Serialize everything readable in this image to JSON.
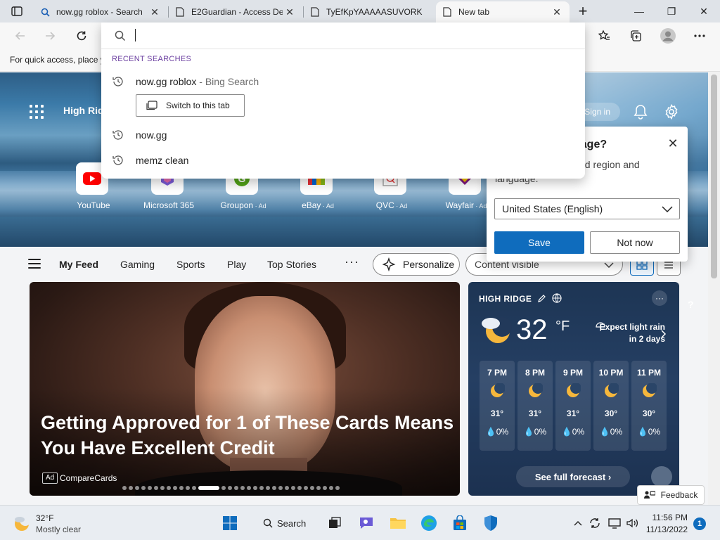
{
  "browser": {
    "tabs": [
      {
        "title": "now.gg roblox - Search",
        "icon": "search-icon",
        "active": false
      },
      {
        "title": "E2Guardian - Access De",
        "icon": "page-icon",
        "active": false
      },
      {
        "title": "TyEfKpYAAAAASUVORK",
        "icon": "page-icon",
        "active": false
      },
      {
        "title": "New tab",
        "icon": "page-icon",
        "active": true
      }
    ],
    "new_tab_symbol": "+",
    "window_controls": {
      "minimize": "—",
      "restore": "❐",
      "close": "✕"
    }
  },
  "address_bar": {
    "value": "",
    "recent_header": "RECENT SEARCHES",
    "suggestions": [
      {
        "text": "now.gg roblox",
        "sub": " - Bing Search"
      },
      {
        "text": "now.gg",
        "sub": ""
      },
      {
        "text": "memz clean",
        "sub": ""
      }
    ],
    "switch_tab_label": "Switch to this tab"
  },
  "favorites_bar": {
    "text": "For quick access, place y"
  },
  "page": {
    "location": "High Rid",
    "signin_label": "Sign in",
    "quick_links": [
      {
        "label": "YouTube",
        "ad": "",
        "color": "#ff0000"
      },
      {
        "label": "Microsoft 365",
        "ad": "",
        "color": "#7b5bd6"
      },
      {
        "label": "Groupon",
        "ad": " · Ad",
        "color": "#53a318"
      },
      {
        "label": "eBay",
        "ad": " · Ad",
        "color": "#e53238"
      },
      {
        "label": "QVC",
        "ad": " · Ad",
        "color": "#9e9e9e"
      },
      {
        "label": "Wayfair",
        "ad": " · Ad",
        "color": "#7f187f"
      }
    ],
    "feed_nav": {
      "items": [
        "My Feed",
        "Gaming",
        "Sports",
        "Play",
        "Top Stories"
      ],
      "more": "···",
      "personalize": "Personalize",
      "content_select": "Content visible"
    },
    "article": {
      "title": "Getting Approved for 1 of These Cards Means You Have Excellent Credit",
      "ad_badge": "Ad",
      "source": "CompareCards"
    },
    "weather": {
      "location": "HIGH RIDGE",
      "temp": "32",
      "unit": "°F",
      "alert": "Expect light rain in 2 days",
      "more": "···",
      "hours": [
        {
          "time": "7 PM",
          "temp": "31°",
          "precip": "0%"
        },
        {
          "time": "8 PM",
          "temp": "31°",
          "precip": "0%"
        },
        {
          "time": "9 PM",
          "temp": "31°",
          "precip": "0%"
        },
        {
          "time": "10 PM",
          "temp": "30°",
          "precip": "0%"
        },
        {
          "time": "11 PM",
          "temp": "30°",
          "precip": "0%"
        }
      ],
      "forecast_btn": "See full forecast ›"
    },
    "feedback_label": "Feedback",
    "question_mark": "?"
  },
  "language_popup": {
    "title": "uage?",
    "description_line1": "ed region and",
    "description_line2": "language.",
    "selected": "United States (English)",
    "save": "Save",
    "not_now": "Not now"
  },
  "taskbar": {
    "weather_temp": "32°F",
    "weather_cond": "Mostly clear",
    "search_label": "Search",
    "time": "11:56 PM",
    "date": "11/13/2022",
    "notifications": "1"
  },
  "colors": {
    "accent": "#0f6cbd",
    "recent_header": "#6b3fa0",
    "weather_card": "#1d3554"
  }
}
